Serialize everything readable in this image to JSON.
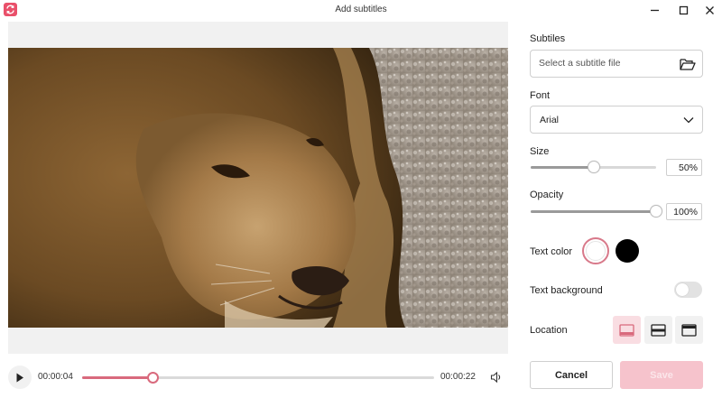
{
  "window": {
    "title": "Add subtitles",
    "icons": {
      "app": "app-logo-icon",
      "minimize": "minimize-icon",
      "maximize": "maximize-icon",
      "close": "close-icon"
    }
  },
  "player": {
    "current_time": "00:00:04",
    "total_time": "00:00:22",
    "progress": 0.2,
    "icons": {
      "play": "play-icon",
      "volume": "volume-icon"
    }
  },
  "panel": {
    "subtitles": {
      "label": "Subtiles",
      "placeholder": "Select a subtitle file",
      "icon": "folder-open-icon"
    },
    "font": {
      "label": "Font",
      "value": "Arial",
      "icon": "chevron-down-icon"
    },
    "size": {
      "label": "Size",
      "value": "50%",
      "level": 0.5
    },
    "opacity": {
      "label": "Opacity",
      "value": "100%",
      "level": 1.0
    },
    "text_color": {
      "label": "Text color",
      "options": [
        "#ffffff",
        "#000000"
      ],
      "selected": "#ffffff"
    },
    "text_background": {
      "label": "Text background",
      "enabled": false
    },
    "location": {
      "label": "Location",
      "options": [
        "bottom",
        "middle",
        "top"
      ],
      "selected": "bottom"
    },
    "buttons": {
      "cancel": "Cancel",
      "save": "Save"
    }
  },
  "colors": {
    "accent": "#e9506a",
    "accent_soft": "#f6c3cc",
    "selected_bg": "#f9dde2"
  }
}
